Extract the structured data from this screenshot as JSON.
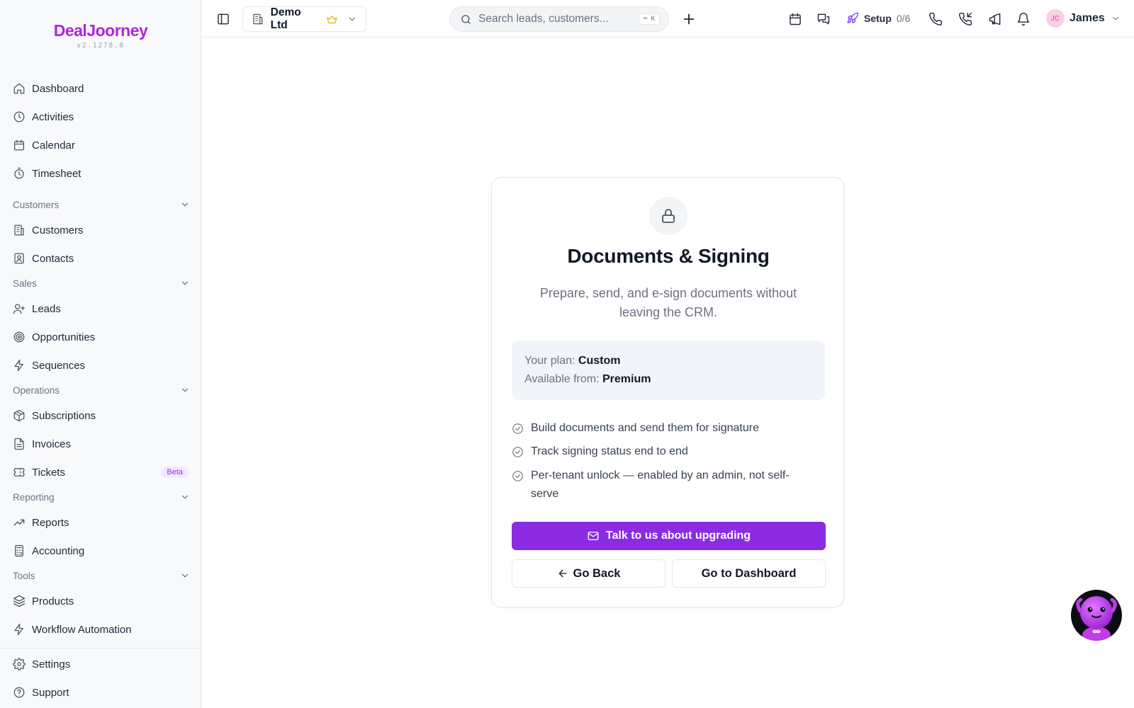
{
  "brand": {
    "name": "DealJoorney",
    "version": "v2.1278.0",
    "accent": "#8b2be2"
  },
  "sidebar": {
    "top_items": [
      {
        "label": "Dashboard",
        "icon": "home-icon"
      },
      {
        "label": "Activities",
        "icon": "clock-icon"
      },
      {
        "label": "Calendar",
        "icon": "calendar-icon"
      },
      {
        "label": "Timesheet",
        "icon": "timer-icon"
      }
    ],
    "sections": [
      {
        "label": "Customers",
        "items": [
          {
            "label": "Customers",
            "icon": "building-icon"
          },
          {
            "label": "Contacts",
            "icon": "contact-card-icon"
          }
        ]
      },
      {
        "label": "Sales",
        "items": [
          {
            "label": "Leads",
            "icon": "user-plus-icon"
          },
          {
            "label": "Opportunities",
            "icon": "target-icon"
          },
          {
            "label": "Sequences",
            "icon": "bolt-icon"
          }
        ]
      },
      {
        "label": "Operations",
        "items": [
          {
            "label": "Subscriptions",
            "icon": "package-icon"
          },
          {
            "label": "Invoices",
            "icon": "document-icon"
          },
          {
            "label": "Tickets",
            "icon": "ticket-icon",
            "badge": "Beta"
          }
        ]
      },
      {
        "label": "Reporting",
        "items": [
          {
            "label": "Reports",
            "icon": "trend-icon"
          },
          {
            "label": "Accounting",
            "icon": "calculator-icon"
          }
        ]
      },
      {
        "label": "Tools",
        "items": [
          {
            "label": "Products",
            "icon": "layers-icon"
          },
          {
            "label": "Workflow Automation",
            "icon": "bolt-icon"
          }
        ]
      }
    ],
    "bottom_items": [
      {
        "label": "Settings",
        "icon": "gear-icon"
      },
      {
        "label": "Support",
        "icon": "help-circle-icon"
      }
    ]
  },
  "header": {
    "company": "Demo Ltd",
    "search": {
      "placeholder": "Search leads, customers...",
      "shortcut": "⌨ K"
    },
    "setup": {
      "label": "Setup",
      "count": "0/6"
    },
    "user": {
      "initials": "JC",
      "name": "James"
    }
  },
  "card": {
    "title": "Documents & Signing",
    "description": "Prepare, send, and e-sign documents without leaving the CRM.",
    "plan_label": "Your plan:",
    "plan_value": "Custom",
    "available_label": "Available from:",
    "available_value": "Premium",
    "features": [
      "Build documents and send them for signature",
      "Track signing status end to end",
      "Per-tenant unlock — enabled by an admin, not self-serve"
    ],
    "primary_button": "Talk to us about upgrading",
    "back_button": "Go Back",
    "dashboard_button": "Go to Dashboard"
  }
}
